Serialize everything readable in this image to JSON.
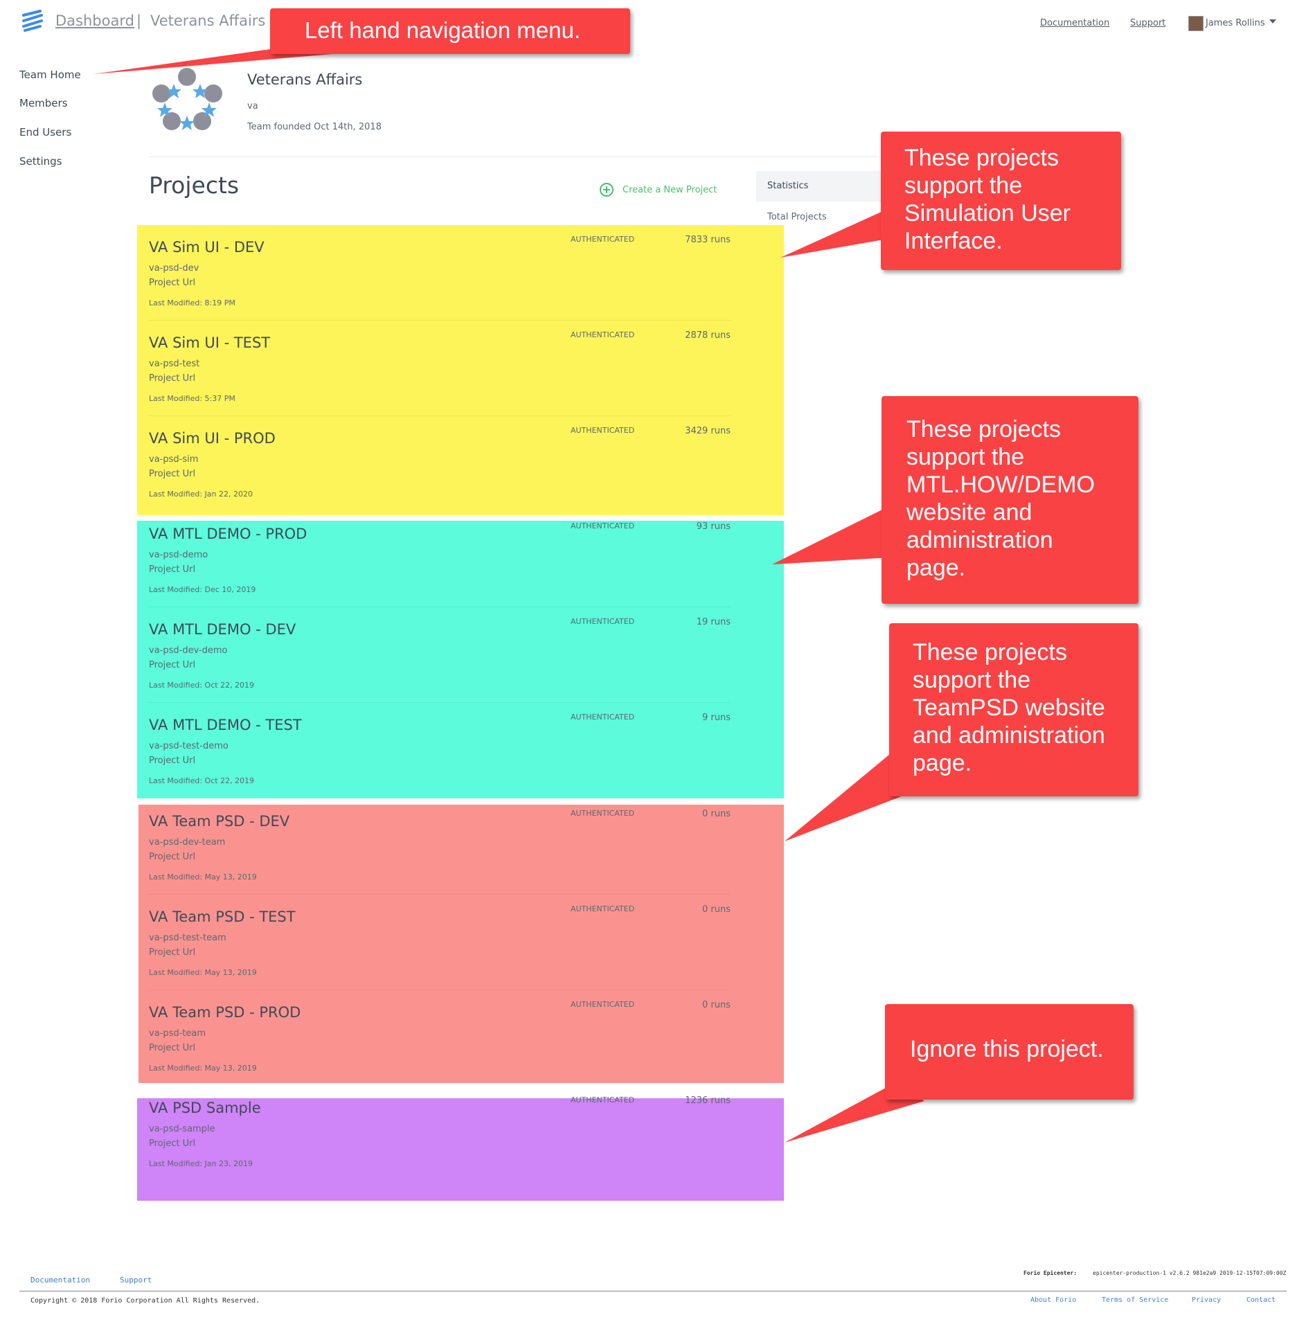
{
  "header": {
    "breadcrumb_dashboard": "Dashboard",
    "breadcrumb_separator": "|",
    "breadcrumb_team": "Veterans Affairs",
    "documentation": "Documentation",
    "support": "Support",
    "user_name": "James Rollins"
  },
  "sidebar": {
    "items": [
      {
        "label": "Team Home"
      },
      {
        "label": "Members"
      },
      {
        "label": "End Users"
      },
      {
        "label": "Settings"
      }
    ]
  },
  "team": {
    "name": "Veterans Affairs",
    "slug": "va",
    "founded": "Team founded Oct 14th, 2018"
  },
  "projects_section": {
    "title": "Projects",
    "create_label": "Create a New Project"
  },
  "statistics": {
    "title": "Statistics",
    "total_projects_label": "Total Projects"
  },
  "projects": [
    {
      "name": "VA Sim UI - DEV",
      "slug": "va-psd-dev",
      "url_label": "Project Url",
      "modified": "Last Modified: 8:19 PM",
      "auth": "AUTHENTICATED",
      "runs": "7833 runs"
    },
    {
      "name": "VA Sim UI - TEST",
      "slug": "va-psd-test",
      "url_label": "Project Url",
      "modified": "Last Modified: 5:37 PM",
      "auth": "AUTHENTICATED",
      "runs": "2878 runs"
    },
    {
      "name": "VA Sim UI - PROD",
      "slug": "va-psd-sim",
      "url_label": "Project Url",
      "modified": "Last Modified: Jan 22, 2020",
      "auth": "AUTHENTICATED",
      "runs": "3429 runs"
    },
    {
      "name": "VA MTL DEMO - PROD",
      "slug": "va-psd-demo",
      "url_label": "Project Url",
      "modified": "Last Modified: Dec 10, 2019",
      "auth": "AUTHENTICATED",
      "runs": "93 runs"
    },
    {
      "name": "VA MTL DEMO - DEV",
      "slug": "va-psd-dev-demo",
      "url_label": "Project Url",
      "modified": "Last Modified: Oct 22, 2019",
      "auth": "AUTHENTICATED",
      "runs": "19 runs"
    },
    {
      "name": "VA MTL DEMO - TEST",
      "slug": "va-psd-test-demo",
      "url_label": "Project Url",
      "modified": "Last Modified: Oct 22, 2019",
      "auth": "AUTHENTICATED",
      "runs": "9 runs"
    },
    {
      "name": "VA Team PSD - DEV",
      "slug": "va-psd-dev-team",
      "url_label": "Project Url",
      "modified": "Last Modified: May 13, 2019",
      "auth": "AUTHENTICATED",
      "runs": "0 runs"
    },
    {
      "name": "VA Team PSD - TEST",
      "slug": "va-psd-test-team",
      "url_label": "Project Url",
      "modified": "Last Modified: May 13, 2019",
      "auth": "AUTHENTICATED",
      "runs": "0 runs"
    },
    {
      "name": "VA Team PSD - PROD",
      "slug": "va-psd-team",
      "url_label": "Project Url",
      "modified": "Last Modified: May 13, 2019",
      "auth": "AUTHENTICATED",
      "runs": "0 runs"
    },
    {
      "name": "VA PSD Sample",
      "slug": "va-psd-sample",
      "url_label": "Project Url",
      "modified": "Last Modified: Jan 23, 2019",
      "auth": "AUTHENTICATED",
      "runs": "1236 runs"
    }
  ],
  "group_colors": [
    "#fdf45a",
    "#5bfbdc",
    "#fa9390",
    "#cf84f8"
  ],
  "callouts": {
    "nav": "Left hand navigation menu.",
    "sim": "These projects\nsupport the\nSimulation User\nInterface.",
    "mtl": "These projects\nsupport the\nMTL.HOW/DEMO\nwebsite and\nadministration\npage.",
    "teampsd": "These projects\nsupport the\nTeamPSD website\nand administration\npage.",
    "ignore": "Ignore this project."
  },
  "footer": {
    "documentation": "Documentation",
    "support": "Support",
    "epicenter_label": "Forio Epicenter:",
    "epicenter_version": "epicenter-production-1 v2.6.2 981e2a9 2019-12-15T07:09:00Z",
    "copyright": "Copyright © 2018 Forio Corporation All Rights Reserved.",
    "about": "About Forio",
    "terms": "Terms of Service",
    "privacy": "Privacy",
    "contact": "Contact"
  }
}
